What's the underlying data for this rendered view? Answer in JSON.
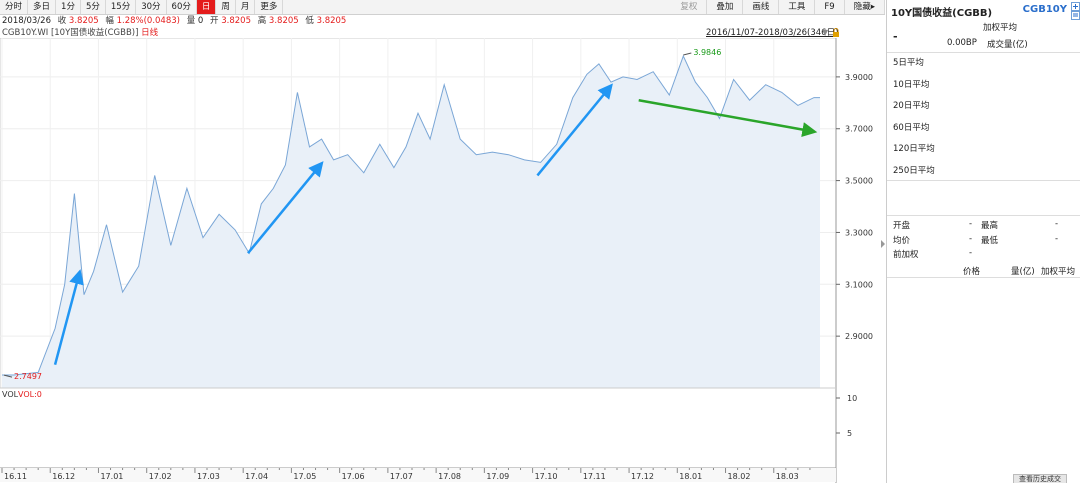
{
  "toolbar": {
    "periods": [
      {
        "label": "分时",
        "active": false
      },
      {
        "label": "多日",
        "active": false
      },
      {
        "label": "1分",
        "active": false
      },
      {
        "label": "5分",
        "active": false
      },
      {
        "label": "15分",
        "active": false
      },
      {
        "label": "30分",
        "active": false
      },
      {
        "label": "60分",
        "active": false
      },
      {
        "label": "日",
        "active": true
      },
      {
        "label": "周",
        "active": false
      },
      {
        "label": "月",
        "active": false
      },
      {
        "label": "更多",
        "active": false
      }
    ],
    "tools": [
      {
        "label": "复权",
        "disabled": true
      },
      {
        "label": "叠加",
        "disabled": false
      },
      {
        "label": "画线",
        "disabled": false
      },
      {
        "label": "工具",
        "disabled": false
      },
      {
        "label": "F9",
        "disabled": false
      },
      {
        "label": "隐藏▸",
        "disabled": false
      }
    ]
  },
  "quote": {
    "date": "2018/03/26",
    "close_label": "收",
    "close": "3.8205",
    "change_label": "幅",
    "change": "1.28%(0.0483)",
    "volume_label": "量",
    "volume": "0",
    "open_label": "开",
    "open": "3.8205",
    "high_label": "高",
    "high": "3.8205",
    "low_label": "低",
    "low": "3.8205"
  },
  "chart_header": {
    "title": "CGB10Y.WI [10Y国债收益(CGBB)]",
    "period": "日线",
    "range": "2016/11/07-2018/03/26(346日)"
  },
  "chart_data": {
    "type": "area",
    "ylim": [
      2.7,
      4.05
    ],
    "yticks": [
      "3.9000",
      "3.7000",
      "3.5000",
      "3.3000",
      "3.1000",
      "2.9000"
    ],
    "xticks": [
      "16.11",
      "16.12",
      "17.01",
      "17.02",
      "17.03",
      "17.04",
      "17.05",
      "17.06",
      "17.07",
      "17.08",
      "17.09",
      "17.10",
      "17.11",
      "17.12",
      "18.01",
      "18.02",
      "18.03"
    ],
    "x": [
      "16.11",
      "16.11",
      "16.12",
      "16.12",
      "16.12",
      "16.12",
      "16.12",
      "17.01",
      "17.01",
      "17.01",
      "17.02",
      "17.02",
      "17.02",
      "17.03",
      "17.03",
      "17.03",
      "17.04",
      "17.04",
      "17.04",
      "17.04",
      "17.05",
      "17.05",
      "17.05",
      "17.05",
      "17.06",
      "17.06",
      "17.06",
      "17.07",
      "17.07",
      "17.07",
      "17.07",
      "17.08",
      "17.08",
      "17.08",
      "17.09",
      "17.09",
      "17.09",
      "17.10",
      "17.10",
      "17.10",
      "17.11",
      "17.11",
      "17.11",
      "17.11",
      "17.12",
      "17.12",
      "17.12",
      "18.01",
      "18.01",
      "18.01",
      "18.01",
      "18.02",
      "18.02",
      "18.02",
      "18.03",
      "18.03",
      "18.03"
    ],
    "values": [
      2.75,
      2.76,
      2.93,
      3.1,
      3.45,
      3.06,
      3.15,
      3.33,
      3.07,
      3.17,
      3.52,
      3.25,
      3.47,
      3.28,
      3.37,
      3.31,
      3.22,
      3.41,
      3.47,
      3.56,
      3.84,
      3.63,
      3.66,
      3.58,
      3.6,
      3.53,
      3.64,
      3.55,
      3.63,
      3.76,
      3.66,
      3.87,
      3.66,
      3.6,
      3.61,
      3.6,
      3.58,
      3.57,
      3.64,
      3.82,
      3.91,
      3.95,
      3.88,
      3.9,
      3.89,
      3.92,
      3.83,
      3.98,
      3.88,
      3.82,
      3.74,
      3.89,
      3.81,
      3.87,
      3.84,
      3.79,
      3.82
    ],
    "series_color": "#7aa6d6",
    "fill_color": "#e9f0f8",
    "annotations": [
      {
        "label": "2.7497",
        "x": "16.11",
        "y": 2.7497,
        "color": "#e41c1c"
      },
      {
        "label": "3.9846",
        "x": "18.01",
        "y": 3.9846,
        "color": "#1a9a1a"
      }
    ],
    "trend_arrows": [
      {
        "color": "#2196f3",
        "x_start": "16.12",
        "y_start": 2.79,
        "x_end": "16.12",
        "y_end": 3.14
      },
      {
        "color": "#2196f3",
        "x_start": "17.04",
        "y_start": 3.22,
        "x_end": "17.05",
        "y_end": 3.56
      },
      {
        "color": "#2196f3",
        "x_start": "17.10",
        "y_start": 3.52,
        "x_end": "17.11",
        "y_end": 3.86
      },
      {
        "color": "#2aa52a",
        "x_start": "17.12",
        "y_start": 3.81,
        "x_end": "18.03",
        "y_end": 3.69
      }
    ],
    "volume_panel": {
      "label": "VOL",
      "value_label": "VOL:0",
      "yticks": [
        "10",
        "5"
      ]
    }
  },
  "sidebar": {
    "title": "10Y国债收益(CGBB)",
    "code": "CGB10Y",
    "price": "-",
    "bp": "0.00BP",
    "wavg_label": "加权平均",
    "vol_label": "成交量(亿)",
    "averages": [
      "5日平均",
      "10日平均",
      "20日平均",
      "60日平均",
      "120日平均",
      "250日平均"
    ],
    "stats": [
      {
        "label": "开盘",
        "value": "-",
        "label2": "最高",
        "value2": "-"
      },
      {
        "label": "均价",
        "value": "-",
        "label2": "最低",
        "value2": "-"
      },
      {
        "label": "前加权",
        "value": "-",
        "label2": "",
        "value2": ""
      }
    ],
    "table_headers": [
      "价格",
      "量(亿)",
      "加权平均"
    ],
    "footer_button": "查看历史成交"
  }
}
